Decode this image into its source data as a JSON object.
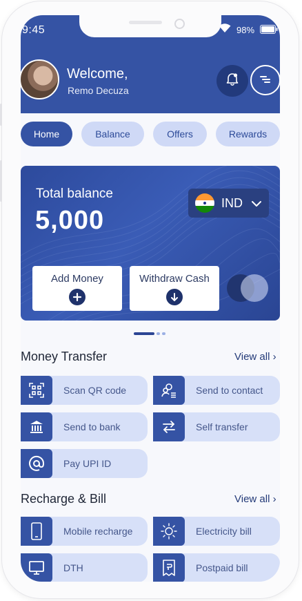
{
  "status_bar": {
    "time": "9:45",
    "battery": "98%"
  },
  "header": {
    "welcome": "Welcome,",
    "user_name": "Remo Decuza"
  },
  "tabs": [
    {
      "label": "Home",
      "active": true
    },
    {
      "label": "Balance",
      "active": false
    },
    {
      "label": "Offers",
      "active": false
    },
    {
      "label": "Rewards",
      "active": false
    }
  ],
  "balance_card": {
    "title": "Total balance",
    "amount": "5,000",
    "currency": "IND",
    "add_money": "Add Money",
    "withdraw_cash": "Withdraw Cash"
  },
  "carousel": {
    "pages": 3,
    "active_index": 0
  },
  "money_transfer": {
    "title": "Money Transfer",
    "view_all": "View all",
    "items": [
      {
        "label": "Scan QR code",
        "icon": "qr-code-icon"
      },
      {
        "label": "Send to contact",
        "icon": "contact-icon"
      },
      {
        "label": "Send to bank",
        "icon": "bank-icon"
      },
      {
        "label": "Self transfer",
        "icon": "transfer-arrows-icon"
      },
      {
        "label": "Pay UPI ID",
        "icon": "at-sign-icon"
      }
    ]
  },
  "recharge_bill": {
    "title": "Recharge & Bill",
    "view_all": "View all",
    "items": [
      {
        "label": "Mobile recharge",
        "icon": "mobile-icon"
      },
      {
        "label": "Electricity bill",
        "icon": "sun-icon"
      },
      {
        "label": "DTH",
        "icon": "tv-icon"
      },
      {
        "label": "Postpaid bill",
        "icon": "bill-icon"
      }
    ]
  },
  "colors": {
    "primary": "#3553a4",
    "dark": "#223a7c",
    "tile_bg": "#d7e0f8",
    "tab_inactive": "#cfd9f6"
  }
}
